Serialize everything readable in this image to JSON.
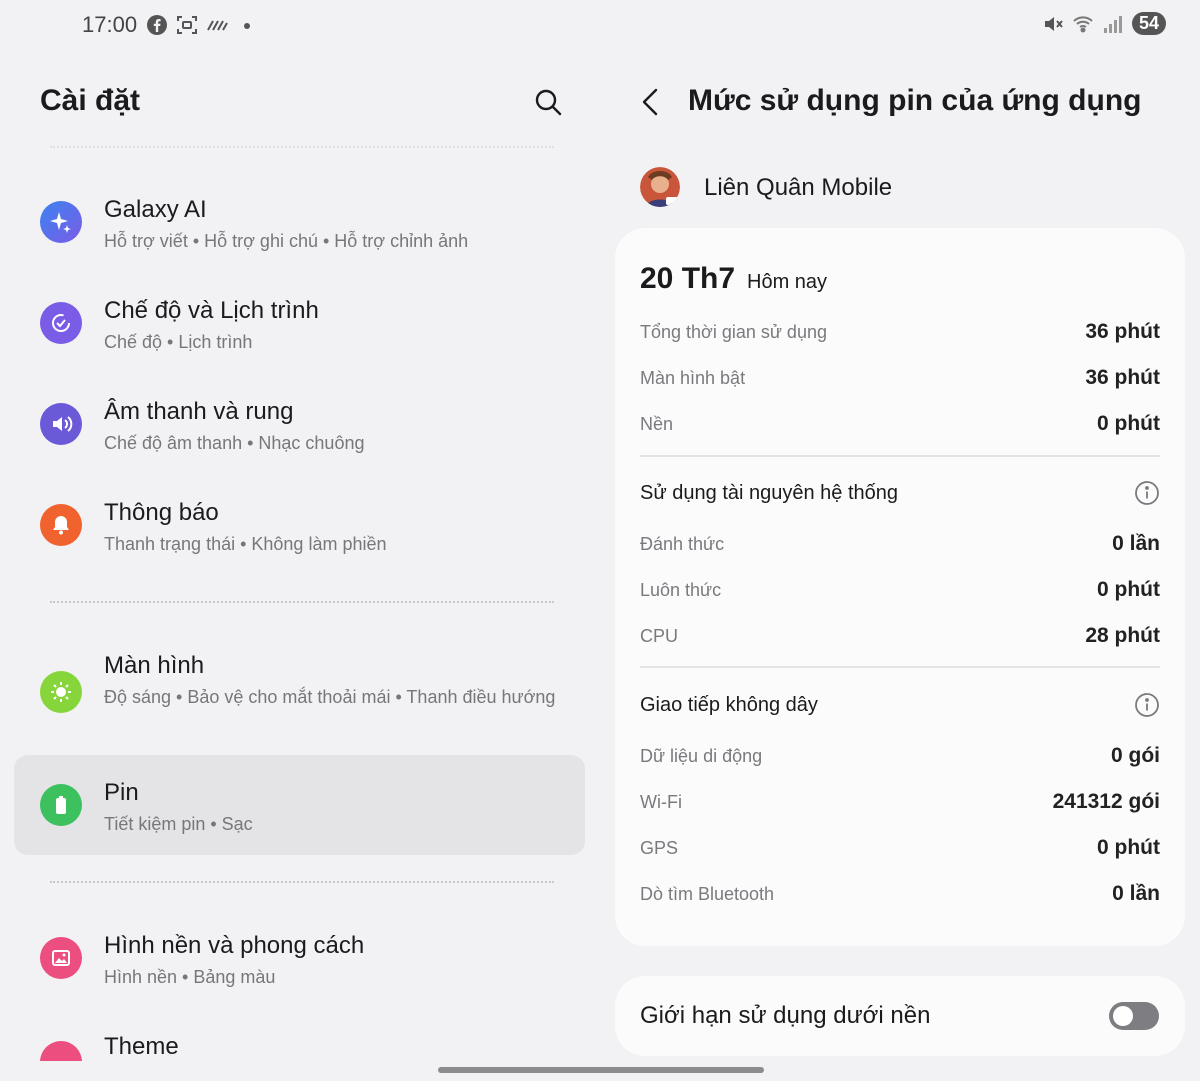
{
  "status_bar": {
    "time": "17:00",
    "left_icons": [
      "facebook-icon",
      "screenshot-icon",
      "signal-lines-icon",
      "dot-icon"
    ],
    "right_icons": [
      "mute-icon",
      "wifi-icon",
      "cellular-signal-icon"
    ],
    "battery": "54"
  },
  "settings": {
    "title": "Cài đặt",
    "search_icon": "search-icon",
    "items": [
      {
        "id": "galaxy-ai",
        "title": "Galaxy AI",
        "subtitle": "Hỗ trợ viết  •  Hỗ trợ ghi chú  •  Hỗ trợ chỉnh ảnh",
        "icon": "sparkle-icon",
        "color": "#3f7cf0",
        "active": false
      },
      {
        "id": "modes",
        "title": "Chế độ và Lịch trình",
        "subtitle": "Chế độ  •  Lịch trình",
        "icon": "routine-check-icon",
        "color": "#7b5ce6",
        "active": false
      },
      {
        "id": "sound",
        "title": "Âm thanh và rung",
        "subtitle": "Chế độ âm thanh  •  Nhạc chuông",
        "icon": "speaker-icon",
        "color": "#6a5ad8",
        "active": false
      },
      {
        "id": "notifications",
        "title": "Thông báo",
        "subtitle": "Thanh trạng thái  •  Không làm phiền",
        "icon": "bell-icon",
        "color": "#f0622e",
        "active": false
      },
      {
        "id": "display",
        "title": "Màn hình",
        "subtitle": "Độ sáng  •  Bảo vệ cho mắt thoải mái  •  Thanh điều hướng",
        "icon": "sun-icon",
        "color": "#86d63b",
        "active": false
      },
      {
        "id": "battery",
        "title": "Pin",
        "subtitle": "Tiết kiệm pin  •  Sạc",
        "icon": "battery-icon",
        "color": "#3dc15e",
        "active": true
      },
      {
        "id": "wallpaper",
        "title": "Hình nền và phong cách",
        "subtitle": "Hình nền  •  Bảng màu",
        "icon": "picture-icon",
        "color": "#ec4f7f",
        "active": false
      },
      {
        "id": "theme",
        "title": "Theme",
        "subtitle": "",
        "icon": "theme-icon",
        "color": "#ec4f7f",
        "active": false
      }
    ]
  },
  "detail": {
    "title": "Mức sử dụng pin của ứng dụng",
    "back_icon": "back-arrow-icon",
    "app_name": "Liên Quân Mobile",
    "date": "20 Th7",
    "date_label": "Hôm nay",
    "usage_rows": [
      {
        "label": "Tổng thời gian sử dụng",
        "value": "36 phút"
      },
      {
        "label": "Màn hình bật",
        "value": "36 phút"
      },
      {
        "label": "Nền",
        "value": "0 phút"
      }
    ],
    "system_section": {
      "title": "Sử dụng tài nguyên hệ thống",
      "rows": [
        {
          "label": "Đánh thức",
          "value": "0 lần"
        },
        {
          "label": "Luôn thức",
          "value": "0 phút"
        },
        {
          "label": "CPU",
          "value": "28 phút"
        }
      ]
    },
    "wireless_section": {
      "title": "Giao tiếp không dây",
      "rows": [
        {
          "label": "Dữ liệu di động",
          "value": "0 gói"
        },
        {
          "label": "Wi-Fi",
          "value": "241312 gói"
        },
        {
          "label": "GPS",
          "value": "0 phút"
        },
        {
          "label": "Dò tìm Bluetooth",
          "value": "0 lần"
        }
      ]
    },
    "background_limit": {
      "label": "Giới hạn sử dụng dưới nền",
      "enabled": false
    }
  }
}
